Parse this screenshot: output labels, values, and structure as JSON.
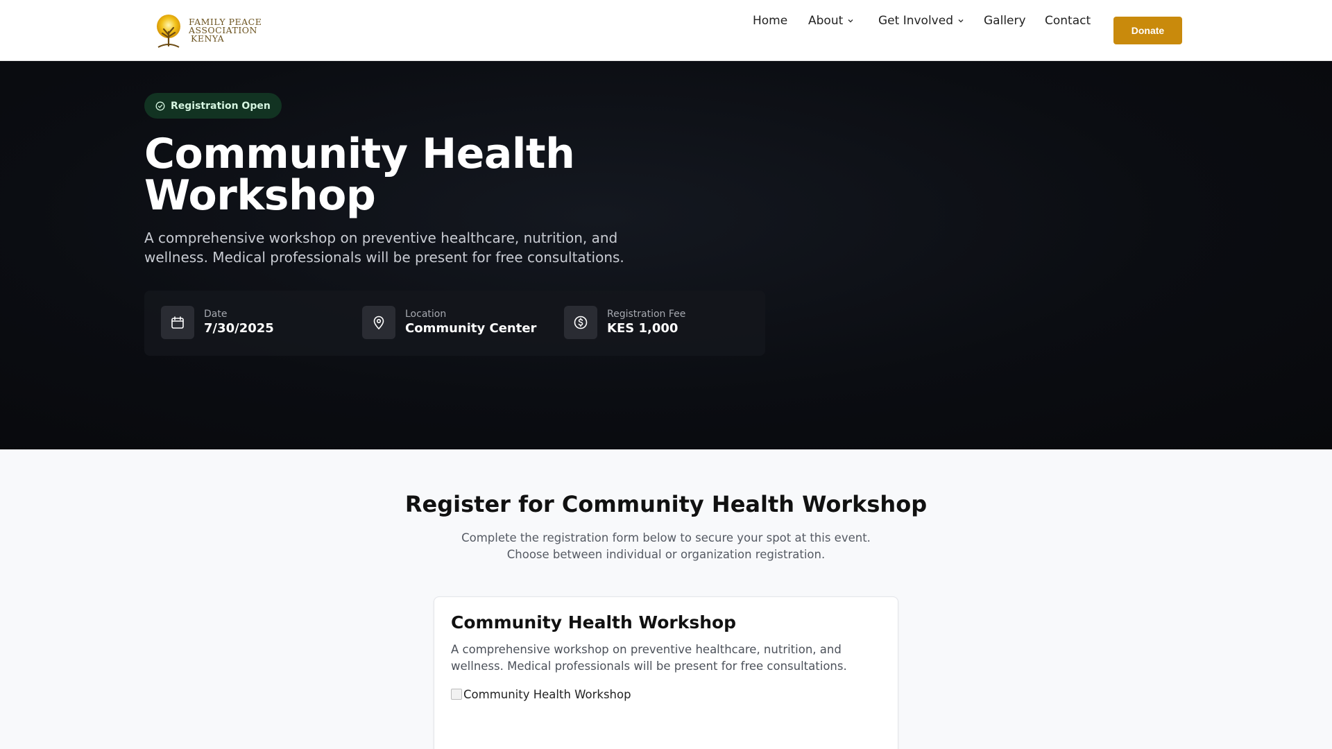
{
  "brand": {
    "line1": "FAMILY PEACE",
    "line2": "ASSOCIATION",
    "line3": "KENYA"
  },
  "nav": {
    "home": "Home",
    "about": "About",
    "get_involved": "Get Involved",
    "gallery": "Gallery",
    "contact": "Contact",
    "donate": "Donate"
  },
  "hero": {
    "badge": "Registration Open",
    "title": "Community Health Workshop",
    "description": "A comprehensive workshop on preventive healthcare, nutrition, and wellness. Medical professionals will be present for free consultations.",
    "date_label": "Date",
    "date_value": "7/30/2025",
    "location_label": "Location",
    "location_value": "Community Center",
    "fee_label": "Registration Fee",
    "fee_value": "KES 1,000"
  },
  "register": {
    "title": "Register for Community Health Workshop",
    "description": "Complete the registration form below to secure your spot at this event. Choose between individual or organization registration."
  },
  "card": {
    "title": "Community Health Workshop",
    "description": "A comprehensive workshop on preventive healthcare, nutrition, and wellness. Medical professionals will be present for free consultations.",
    "image_alt": "Community Health Workshop"
  },
  "colors": {
    "accent": "#c98a0c",
    "hero_bg": "#0b0d12",
    "badge_bg": "#123322",
    "badge_text": "#d6f5e1"
  },
  "icons": {
    "badge": "check-circle-icon",
    "date": "calendar-icon",
    "location": "map-pin-icon",
    "fee": "dollar-circle-icon",
    "dropdown": "chevron-down-icon"
  }
}
